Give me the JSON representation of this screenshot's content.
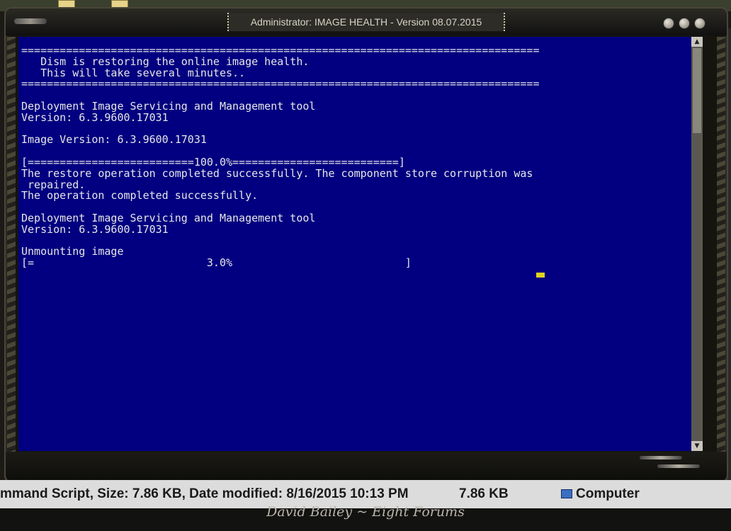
{
  "window": {
    "title": "Administrator:  IMAGE HEALTH - Version 08.07.2015"
  },
  "console": {
    "lines": [
      "=================================================================================",
      "   Dism is restoring the online image health.",
      "   This will take several minutes..",
      "=================================================================================",
      "",
      "Deployment Image Servicing and Management tool",
      "Version: 6.3.9600.17031",
      "",
      "Image Version: 6.3.9600.17031",
      "",
      "[==========================100.0%==========================]",
      "The restore operation completed successfully. The component store corruption was",
      " repaired.",
      "The operation completed successfully.",
      "",
      "Deployment Image Servicing and Management tool",
      "Version: 6.3.9600.17031",
      "",
      "Unmounting image",
      "[=                           3.0%                           ] "
    ]
  },
  "details_bar": {
    "file_info": "mmand Script, Size: 7.86 KB, Date modified: 8/16/2015 10:13 PM",
    "size": "7.86 KB",
    "location": "Computer"
  },
  "signature": "David Bailey ~ Eight Forums",
  "colors": {
    "console_bg": "#020080",
    "console_text": "#e6e6e6",
    "cursor": "#e1d21f"
  }
}
